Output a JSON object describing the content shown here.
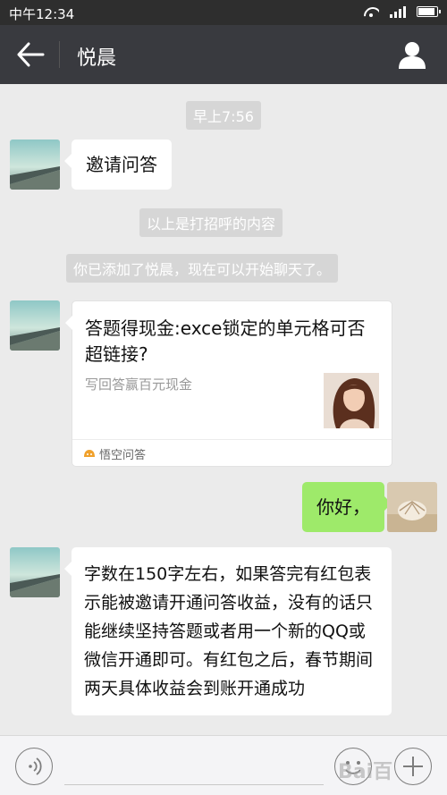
{
  "status_bar": {
    "time": "中午12:34"
  },
  "header": {
    "title": "悦晨"
  },
  "messages": {
    "timestamp": "早上7:56",
    "m1_text": "邀请问答",
    "sys1": "以上是打招呼的内容",
    "sys2": "你已添加了悦晨，现在可以开始聊天了。",
    "card": {
      "title": "答题得现金:exce锁定的单元格可否超链接?",
      "description": "写回答赢百元现金",
      "source": "悟空问答"
    },
    "m2_text": "你好，",
    "m3_text": "字数在150字左右，如果答完有红包表示能被邀请开通问答收益，没有的话只能继续坚持答题或者用一个新的QQ或微信开通即可。有红包之后，春节期间两天具体收益会到账开通成功"
  },
  "input_bar": {
    "watermark": "Bai百"
  },
  "colors": {
    "status_bar": "#2e2e2e",
    "title_bar": "#393a3f",
    "chat_bg": "#ebebeb",
    "outgoing_bubble": "#9eea6a",
    "system_notice": "#d6d6d6"
  }
}
